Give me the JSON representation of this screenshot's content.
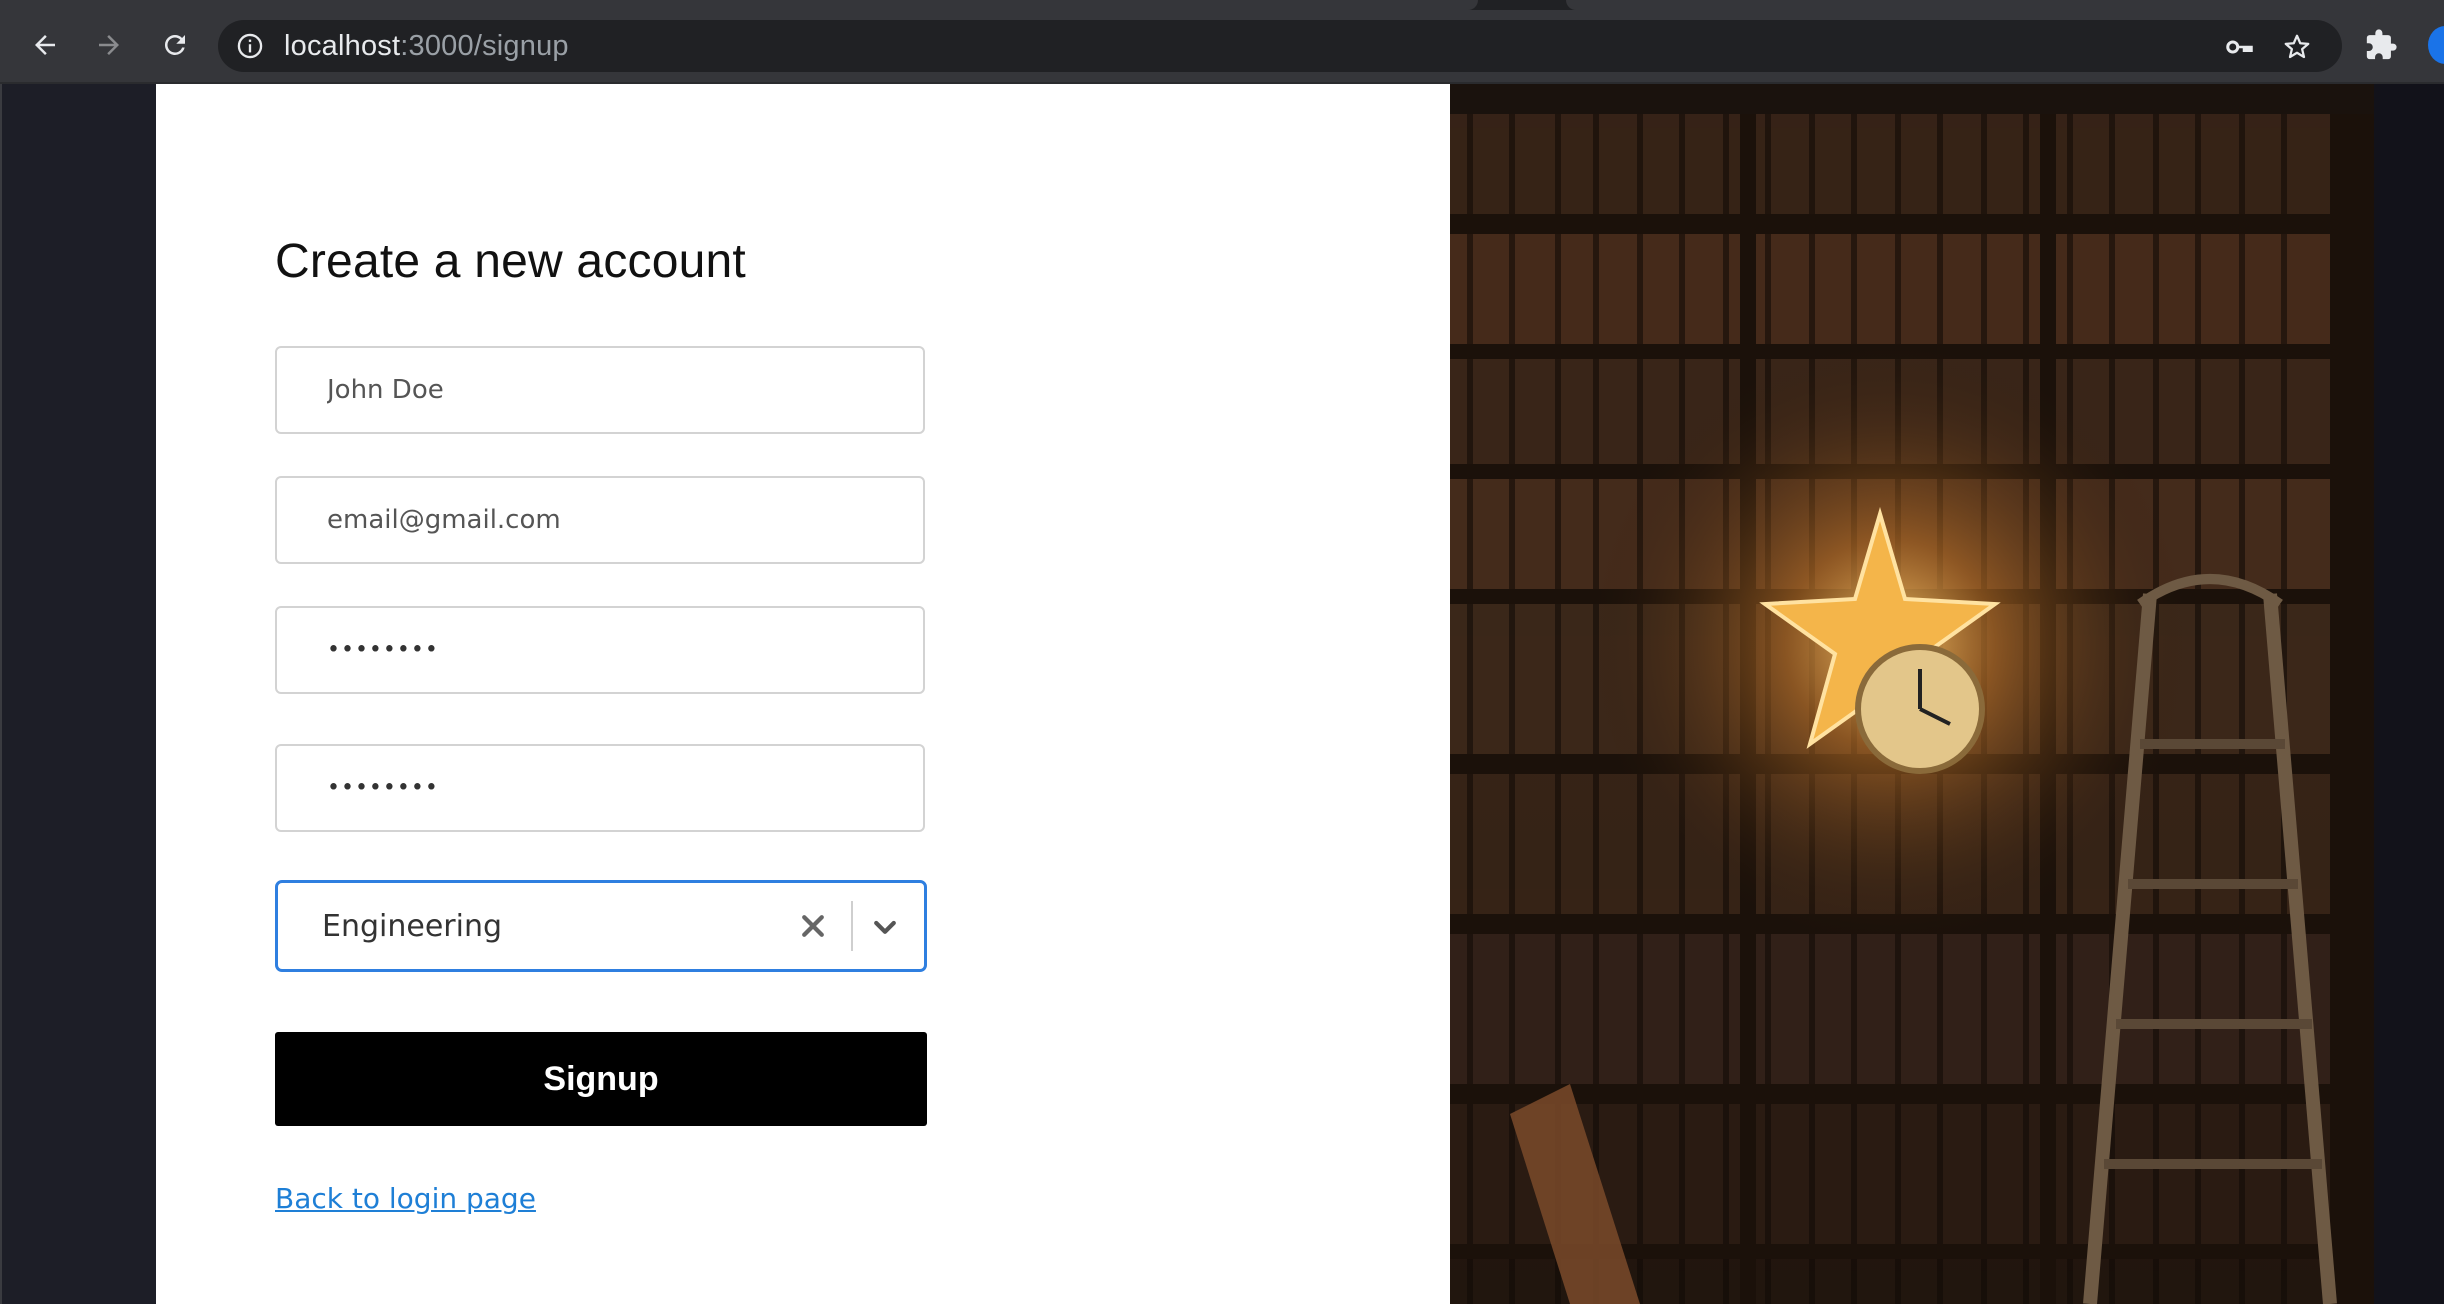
{
  "browser": {
    "url_host": "localhost",
    "url_path": ":3000/signup",
    "icons": [
      "back-arrow-icon",
      "forward-arrow-icon",
      "reload-icon",
      "site-info-icon",
      "key-icon",
      "star-icon",
      "extensions-icon",
      "profile-avatar"
    ]
  },
  "form": {
    "title": "Create a new account",
    "name_placeholder": "John Doe",
    "email_placeholder": "email@gmail.com",
    "password_value": "••••••••",
    "confirm_password_value": "••••••••",
    "department_selected": "Engineering",
    "signup_label": "Signup",
    "back_link": "Back to login page"
  },
  "colors": {
    "accent_focus": "#2f7fe0",
    "link": "#1e7fd6",
    "button_bg": "#000000"
  },
  "image": {
    "description_icon": "bookshelf-photo"
  }
}
